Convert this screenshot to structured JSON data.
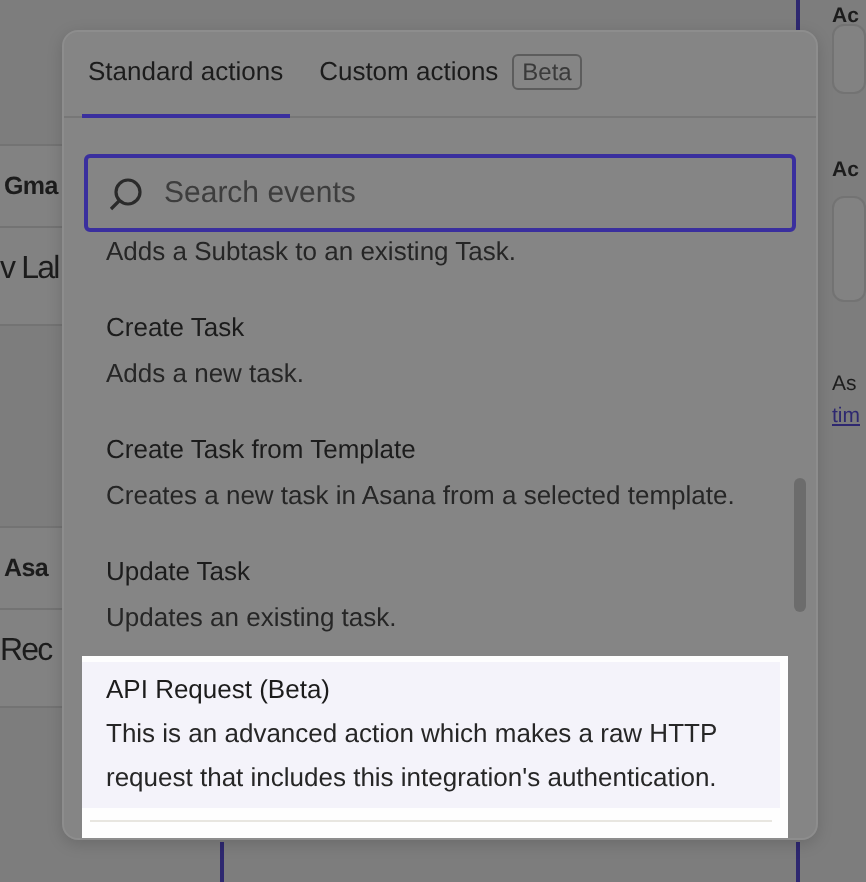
{
  "background": {
    "left_cards": [
      {
        "header": "Gma",
        "title": "v Lal"
      },
      {
        "header": "Asa",
        "title": "Rec"
      }
    ],
    "right_panel": {
      "labels": [
        "Ac",
        "Ac"
      ],
      "note": "As",
      "link": "tim"
    }
  },
  "tabs": [
    {
      "label": "Standard actions",
      "selected": true
    },
    {
      "label": "Custom actions",
      "selected": false,
      "badge": "Beta"
    }
  ],
  "search": {
    "placeholder": "Search events"
  },
  "actions": [
    {
      "description": "Adds a Subtask to an existing Task.",
      "highlighted": false
    },
    {
      "title": "Create Task",
      "description": "Adds a new task.",
      "highlighted": false
    },
    {
      "title": "Create Task from Template",
      "description": "Creates a new task in Asana from a selected template.",
      "highlighted": false
    },
    {
      "title": "Update Task",
      "description": "Updates an existing task.",
      "highlighted": false
    },
    {
      "title": "API Request (Beta)",
      "description": "This is an advanced action which makes a raw HTTP request that includes this integration's authentication.",
      "highlighted": true
    }
  ]
}
